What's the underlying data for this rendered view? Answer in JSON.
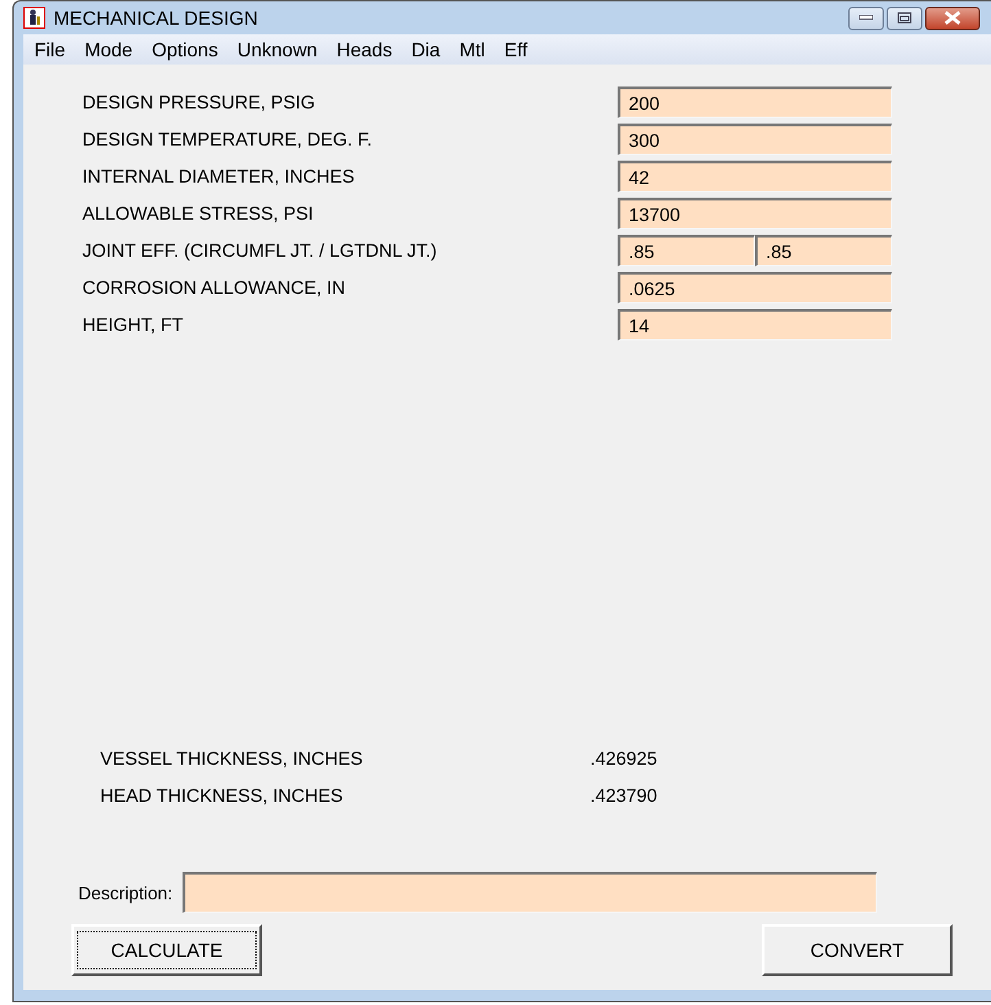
{
  "window": {
    "title": "MECHANICAL DESIGN"
  },
  "menu": [
    "File",
    "Mode",
    "Options",
    "Unknown",
    "Heads",
    "Dia",
    "Mtl",
    "Eff"
  ],
  "inputs": [
    {
      "label": "DESIGN PRESSURE, PSIG",
      "values": [
        "200"
      ]
    },
    {
      "label": "DESIGN TEMPERATURE, DEG. F.",
      "values": [
        "300"
      ]
    },
    {
      "label": "INTERNAL DIAMETER, INCHES",
      "values": [
        "42"
      ]
    },
    {
      "label": "ALLOWABLE STRESS, PSI",
      "values": [
        "13700"
      ]
    },
    {
      "label": "JOINT EFF. (CIRCUMFL JT. / LGTDNL JT.)",
      "values": [
        ".85",
        ".85"
      ]
    },
    {
      "label": "CORROSION ALLOWANCE, IN",
      "values": [
        ".0625"
      ]
    },
    {
      "label": "HEIGHT, FT",
      "values": [
        "14"
      ]
    }
  ],
  "results": [
    {
      "label": "VESSEL THICKNESS, INCHES",
      "value": ".426925"
    },
    {
      "label": "HEAD THICKNESS, INCHES",
      "value": ".423790"
    }
  ],
  "description": {
    "label": "Description:"
  },
  "buttons": [
    {
      "label": "CALCULATE",
      "focused": true
    },
    {
      "label": "CONVERT",
      "focused": false
    }
  ]
}
